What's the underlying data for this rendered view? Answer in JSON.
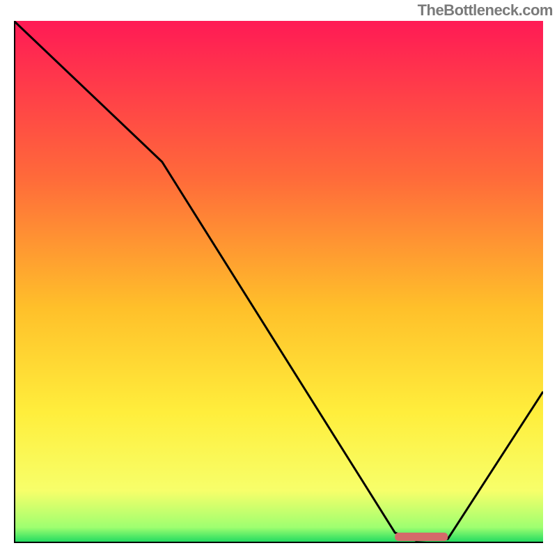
{
  "watermark": "TheBottleneck.com",
  "chart_data": {
    "type": "line",
    "title": "",
    "xlabel": "",
    "ylabel": "",
    "xlim": [
      0,
      100
    ],
    "ylim": [
      0,
      100
    ],
    "x": [
      0,
      28,
      72,
      76,
      82,
      100
    ],
    "values": [
      100,
      73,
      2,
      0.5,
      0.8,
      29
    ],
    "gradient_stops": [
      {
        "offset": 0,
        "color": "#ff1a55"
      },
      {
        "offset": 0.3,
        "color": "#ff6a3a"
      },
      {
        "offset": 0.55,
        "color": "#ffc02a"
      },
      {
        "offset": 0.75,
        "color": "#ffee3c"
      },
      {
        "offset": 0.9,
        "color": "#f7ff6a"
      },
      {
        "offset": 0.97,
        "color": "#9eff70"
      },
      {
        "offset": 1.0,
        "color": "#18d860"
      }
    ],
    "marker": {
      "x_start": 72,
      "x_end": 82,
      "y": 1.2,
      "color": "#d46a6a"
    },
    "axis_color": "#000000",
    "line_color": "#000000",
    "line_width": 3
  }
}
